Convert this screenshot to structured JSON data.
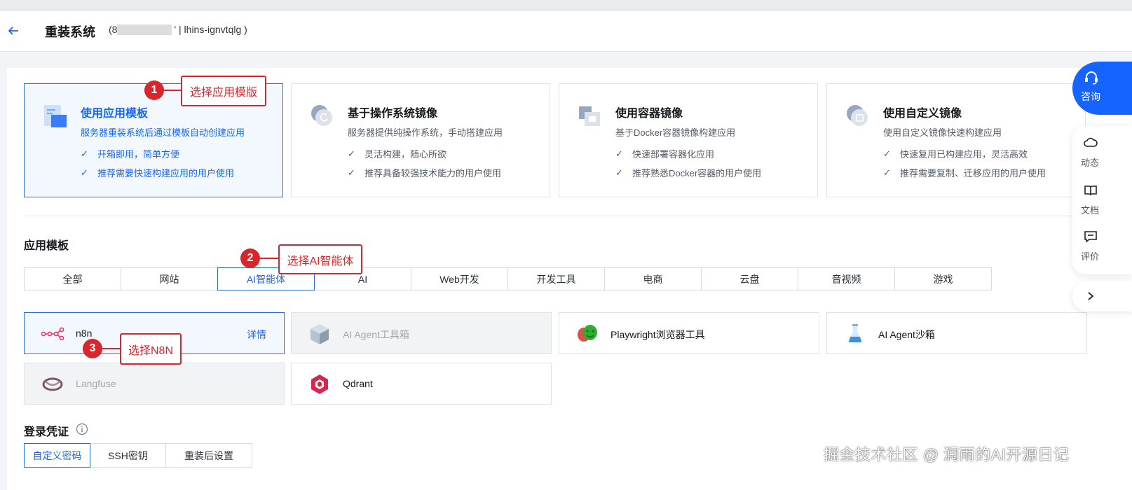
{
  "header": {
    "title": "重装系统",
    "instance_prefix": "(8",
    "instance_suffix": "' | lhins-ignvtqlg )"
  },
  "modes": [
    {
      "title": "使用应用模板",
      "desc": "服务器重装系统后通过模板自动创建应用",
      "features": [
        "开箱即用，简单方便",
        "推荐需要快速构建应用的用户使用"
      ],
      "selected": true
    },
    {
      "title": "基于操作系统镜像",
      "desc": "服务器提供纯操作系统，手动搭建应用",
      "features": [
        "灵活构建，随心所欲",
        "推荐具备较强技术能力的用户使用"
      ],
      "selected": false
    },
    {
      "title": "使用容器镜像",
      "desc": "基于Docker容器镜像构建应用",
      "features": [
        "快速部署容器化应用",
        "推荐熟悉Docker容器的用户使用"
      ],
      "selected": false
    },
    {
      "title": "使用自定义镜像",
      "desc": "使用自定义镜像快速构建应用",
      "features": [
        "快速复用已构建应用，灵活高效",
        "推荐需要复制、迁移应用的用户使用"
      ],
      "selected": false
    }
  ],
  "app_template": {
    "heading": "应用模板",
    "tabs": [
      "全部",
      "网站",
      "AI智能体",
      "AI",
      "Web开发",
      "开发工具",
      "电商",
      "云盘",
      "音视频",
      "游戏"
    ],
    "active_tab": "AI智能体",
    "apps": [
      {
        "name": "n8n",
        "detail": "详情",
        "state": "selected",
        "icon": "n8n-logo-icon"
      },
      {
        "name": "AI Agent工具箱",
        "state": "disabled",
        "icon": "ai-agent-toolbox-icon"
      },
      {
        "name": "Playwright浏览器工具",
        "state": "normal",
        "icon": "playwright-masks-icon"
      },
      {
        "name": "AI Agent沙箱",
        "state": "normal",
        "icon": "flask-icon"
      },
      {
        "name": "Langfuse",
        "state": "disabled",
        "icon": "langfuse-logo-icon"
      },
      {
        "name": "Qdrant",
        "state": "normal",
        "icon": "qdrant-logo-icon"
      }
    ]
  },
  "login": {
    "heading": "登录凭证",
    "tabs": [
      "自定义密码",
      "SSH密钥",
      "重装后设置"
    ],
    "active_tab": "自定义密码"
  },
  "annotations": [
    {
      "num": "1",
      "text": "选择应用模版"
    },
    {
      "num": "2",
      "text": "选择AI智能体"
    },
    {
      "num": "3",
      "text": "选择N8N"
    }
  ],
  "side": {
    "consult": "咨询",
    "items": [
      "动态",
      "文档",
      "评价"
    ]
  },
  "watermark": "掘金技术社区 @ 润雨的AI开源日记",
  "colors": {
    "accent": "#1664ff",
    "annotation": "#d9262c",
    "selected_bg": "#f3f8ff"
  }
}
